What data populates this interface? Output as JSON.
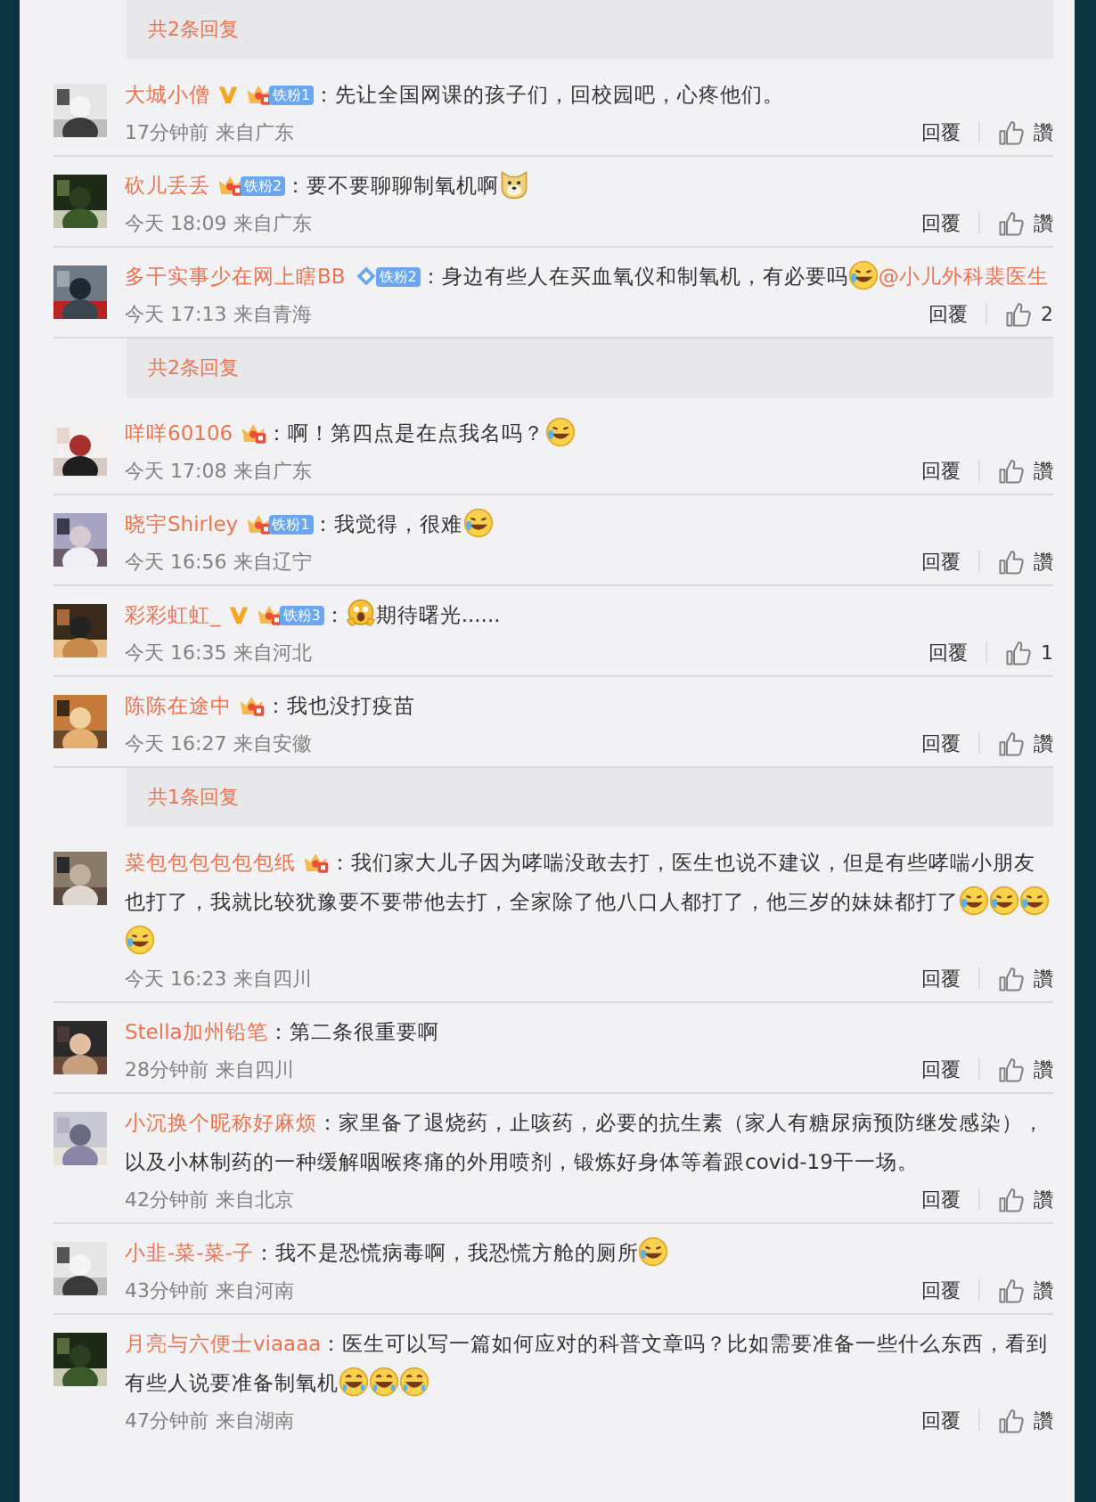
{
  "feed": [
    {
      "kind": "replies",
      "label": "共2条回复"
    },
    {
      "kind": "comment",
      "name": "大城小僧",
      "verified": true,
      "badge": {
        "kind": "crown",
        "label": "铁粉1"
      },
      "content": [
        {
          "kind": "text",
          "text": "：先让全国网课的孩子们，回校园吧，心疼他们。"
        }
      ],
      "time": "17分钟前",
      "source": "来自广东",
      "reply": "回覆",
      "like": "讚"
    },
    {
      "kind": "comment",
      "name": "砍儿丢丢",
      "verified": false,
      "badge": {
        "kind": "crown",
        "label": "铁粉2"
      },
      "content": [
        {
          "kind": "text",
          "text": "：要不要聊聊制氧机啊"
        },
        {
          "kind": "dog"
        }
      ],
      "time": "今天 18:09",
      "source": "来自广东",
      "reply": "回覆",
      "like": "讚"
    },
    {
      "kind": "comment",
      "name": "多干实事少在网上瞎BB",
      "verified": false,
      "badge": {
        "kind": "diamond",
        "label": "铁粉2"
      },
      "content": [
        {
          "kind": "text",
          "text": "：身边有些人在买血氧仪和制氧机，有必要吗"
        },
        {
          "kind": "cry_laugh"
        },
        {
          "kind": "mention",
          "text": "@小儿外科裴医生"
        }
      ],
      "time": "今天 17:13",
      "source": "来自青海",
      "reply": "回覆",
      "like": "2"
    },
    {
      "kind": "replies",
      "label": "共2条回复"
    },
    {
      "kind": "comment",
      "name": "咩咩60106",
      "verified": false,
      "badge": {
        "kind": "crown"
      },
      "content": [
        {
          "kind": "text",
          "text": "：啊！第四点是在点我名吗？"
        },
        {
          "kind": "cry_laugh"
        }
      ],
      "time": "今天 17:08",
      "source": "来自广东",
      "reply": "回覆",
      "like": "讚"
    },
    {
      "kind": "comment",
      "name": "晓宇Shirley",
      "verified": false,
      "badge": {
        "kind": "crown",
        "label": "铁粉1"
      },
      "content": [
        {
          "kind": "text",
          "text": "：我觉得，很难"
        },
        {
          "kind": "cry_laugh"
        }
      ],
      "time": "今天 16:56",
      "source": "来自辽宁",
      "reply": "回覆",
      "like": "讚"
    },
    {
      "kind": "comment",
      "name": "彩彩虹虹_",
      "verified": true,
      "badge": {
        "kind": "crown",
        "label": "铁粉3"
      },
      "content": [
        {
          "kind": "text",
          "text": "："
        },
        {
          "kind": "scream"
        },
        {
          "kind": "text",
          "text": "期待曙光......"
        }
      ],
      "time": "今天 16:35",
      "source": "来自河北",
      "reply": "回覆",
      "like": "1"
    },
    {
      "kind": "comment",
      "name": "陈陈在途中",
      "verified": false,
      "badge": {
        "kind": "crown"
      },
      "content": [
        {
          "kind": "text",
          "text": "：我也没打疫苗"
        }
      ],
      "time": "今天 16:27",
      "source": "来自安徽",
      "reply": "回覆",
      "like": "讚"
    },
    {
      "kind": "replies",
      "label": "共1条回复"
    },
    {
      "kind": "comment",
      "name": "菜包包包包包包纸",
      "verified": false,
      "badge": {
        "kind": "crown"
      },
      "content": [
        {
          "kind": "text",
          "text": "：我们家大儿子因为哮喘没敢去打，医生也说不建议，但是有些哮喘小朋友也打了，我就比较犹豫要不要带他去打，全家除了他八口人都打了，他三岁的妹妹都打了"
        },
        {
          "kind": "cry_laugh"
        },
        {
          "kind": "cry_laugh"
        },
        {
          "kind": "cry_laugh"
        },
        {
          "kind": "cry_laugh"
        }
      ],
      "time": "今天 16:23",
      "source": "来自四川",
      "reply": "回覆",
      "like": "讚"
    },
    {
      "kind": "comment",
      "name": "Stella加州铅笔",
      "verified": false,
      "content": [
        {
          "kind": "text",
          "text": "：第二条很重要啊"
        }
      ],
      "time": "28分钟前",
      "source": "来自四川",
      "reply": "回覆",
      "like": "讚"
    },
    {
      "kind": "comment",
      "name": "小沉换个昵称好麻烦",
      "verified": false,
      "content": [
        {
          "kind": "text",
          "text": "：家里备了退烧药，止咳药，必要的抗生素（家人有糖尿病预防继发感染），以及小林制药的一种缓解咽喉疼痛的外用喷剂，锻炼好身体等着跟covid-19干一场。"
        }
      ],
      "time": "42分钟前",
      "source": "来自北京",
      "reply": "回覆",
      "like": "讚"
    },
    {
      "kind": "comment",
      "name": "小韭-菜-菜-子",
      "verified": false,
      "content": [
        {
          "kind": "text",
          "text": "：我不是恐慌病毒啊，我恐慌方舱的厕所"
        },
        {
          "kind": "cry_laugh"
        }
      ],
      "time": "43分钟前",
      "source": "来自河南",
      "reply": "回覆",
      "like": "讚"
    },
    {
      "kind": "comment",
      "name": "月亮与六便士viaaaa",
      "verified": false,
      "content": [
        {
          "kind": "text",
          "text": "：医生可以写一篇如何应对的科普文章吗？比如需要准备一些什么东西，看到有些人说要准备制氧机"
        },
        {
          "kind": "grin"
        },
        {
          "kind": "grin"
        },
        {
          "kind": "grin"
        }
      ],
      "time": "47分钟前",
      "source": "来自湖南",
      "reply": "回覆",
      "like": "讚"
    }
  ]
}
